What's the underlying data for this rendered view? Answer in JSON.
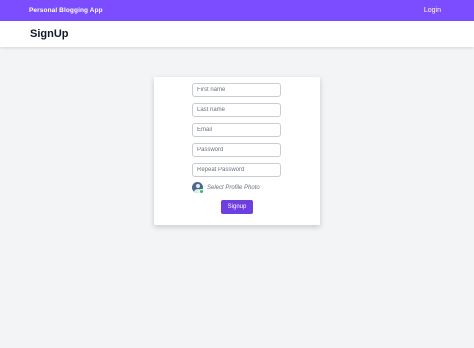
{
  "header": {
    "brand": "Personal Blogging App",
    "login_label": "Login"
  },
  "page": {
    "title": "SignUp"
  },
  "form": {
    "first_name": {
      "value": "",
      "placeholder": "First name"
    },
    "last_name": {
      "value": "",
      "placeholder": "Last name"
    },
    "email": {
      "value": "",
      "placeholder": "Email"
    },
    "password": {
      "value": "",
      "placeholder": "Password"
    },
    "repeat_password": {
      "value": "",
      "placeholder": "Repeat Password"
    },
    "profile_photo_label": "Select Profile Photo",
    "submit_label": "Signup"
  },
  "colors": {
    "brand_purple": "#7c4dff",
    "button_purple": "#6d3fe0",
    "badge_green": "#22c55e",
    "page_background": "#f3f4f6"
  },
  "icons": {
    "avatar": "user-avatar-icon",
    "badge": "add-badge-icon"
  }
}
